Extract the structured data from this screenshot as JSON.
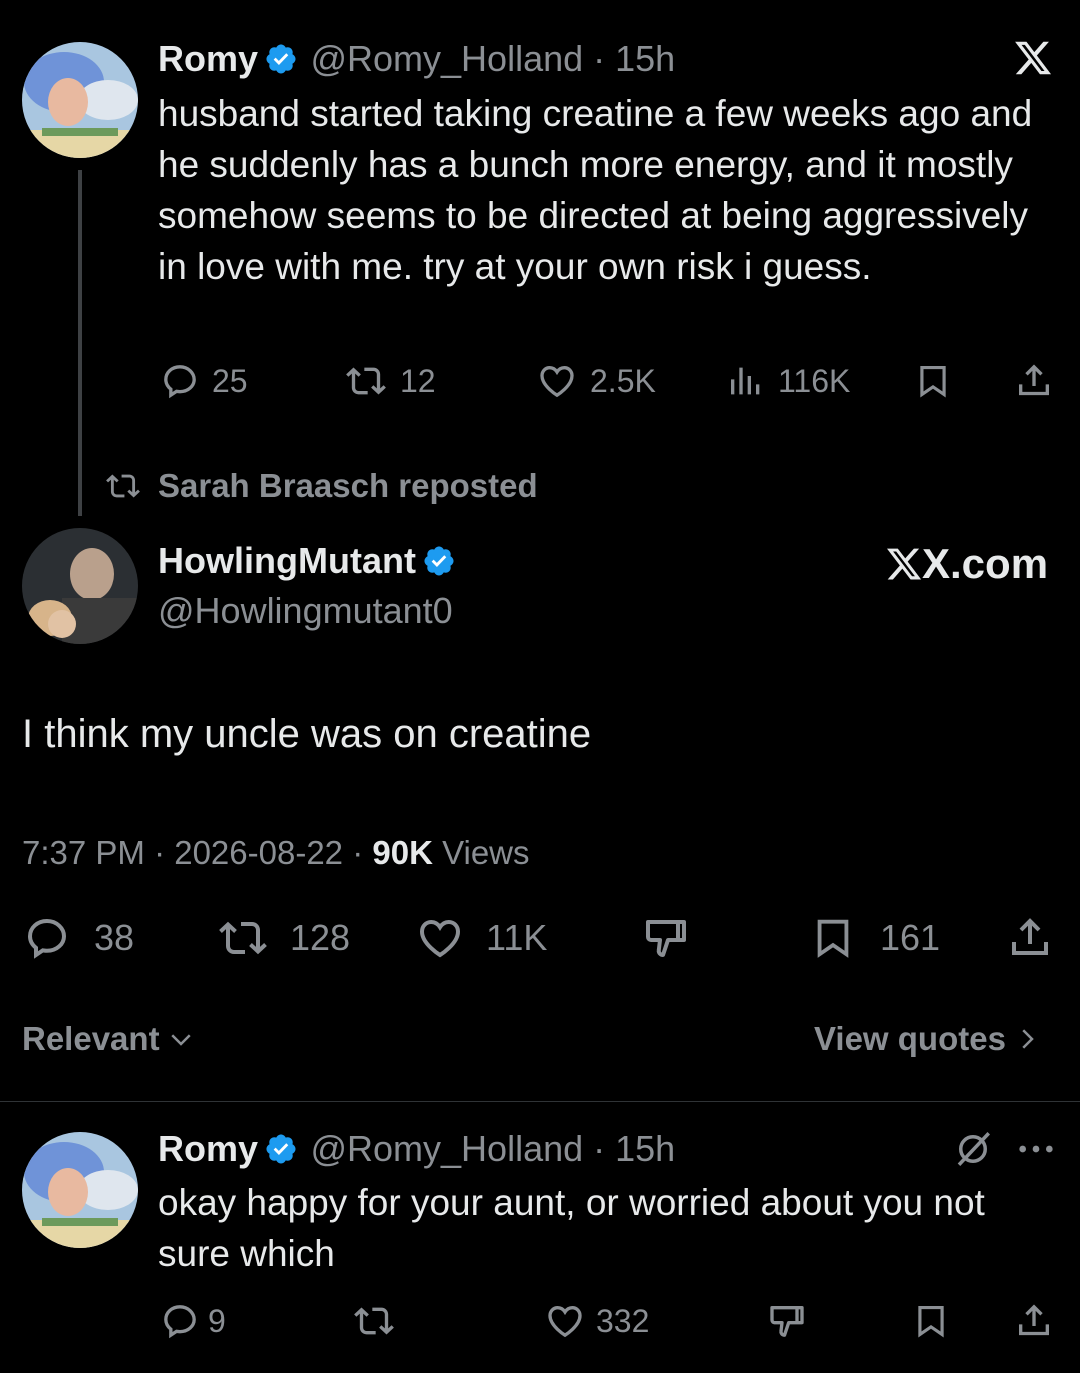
{
  "tweet1": {
    "name": "Romy",
    "handle": "@Romy_Holland",
    "time": "15h",
    "text": "husband started taking creatine a few weeks ago and he suddenly has a bunch more energy, and it mostly somehow seems to be directed at being aggressively in love with me. try at your own risk i guess.",
    "replies": "25",
    "reposts": "12",
    "likes": "2.5K",
    "views": "116K"
  },
  "repost_banner": "Sarah Braasch reposted",
  "tweet2": {
    "name": "HowlingMutant",
    "handle": "@Howlingmutant0",
    "text": "I think my uncle was on creatine",
    "timestamp": "7:37 PM · 2026-08-22 · ",
    "views_count": "90K",
    "views_label": " Views",
    "replies": "38",
    "reposts": "128",
    "likes": "11K",
    "bookmarks": "161"
  },
  "watermark": "X.com",
  "sort_label": "Relevant",
  "view_quotes": "View quotes",
  "reply": {
    "name": "Romy",
    "handle": "@Romy_Holland",
    "time": "15h",
    "text": "okay happy for your aunt, or worried about you not sure which",
    "replies": "9",
    "likes": "332"
  },
  "colors": {
    "background": "#000000",
    "text": "#e7e9ea",
    "secondary": "#8b8f94",
    "verified": "#1d9bf0"
  }
}
